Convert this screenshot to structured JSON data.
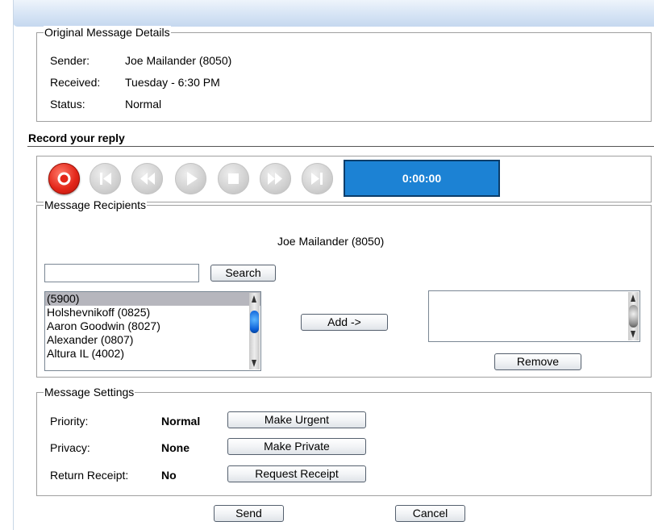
{
  "original_message": {
    "legend": "Original Message Details",
    "sender_label": "Sender:",
    "sender_value": "Joe Mailander (8050)",
    "received_label": "Received:",
    "received_value": "Tuesday - 6:30 PM",
    "status_label": "Status:",
    "status_value": "Normal"
  },
  "record": {
    "title": "Record your reply",
    "timer": "0:00:00",
    "controls": [
      "record",
      "skip-back",
      "rewind",
      "play",
      "stop",
      "fast-forward",
      "skip-forward"
    ]
  },
  "recipients": {
    "legend": "Message Recipients",
    "current": "Joe Mailander (8050)",
    "search_value": "",
    "search_button": "Search",
    "directory": [
      "(5900)",
      "Holshevnikoff (0825)",
      "Aaron Goodwin (8027)",
      "Alexander (0807)",
      "Altura IL (4002)"
    ],
    "selected_index": 0,
    "add_button": "Add ->",
    "remove_button": "Remove"
  },
  "settings": {
    "legend": "Message Settings",
    "priority_label": "Priority:",
    "priority_value": "Normal",
    "priority_button": "Make Urgent",
    "privacy_label": "Privacy:",
    "privacy_value": "None",
    "privacy_button": "Make Private",
    "receipt_label": "Return Receipt:",
    "receipt_value": "No",
    "receipt_button": "Request Receipt"
  },
  "footer": {
    "send_button": "Send",
    "cancel_button": "Cancel"
  },
  "colors": {
    "record_red": "#e32619",
    "timer_blue": "#1c82d4",
    "selection_gray": "#b6b6bd"
  }
}
